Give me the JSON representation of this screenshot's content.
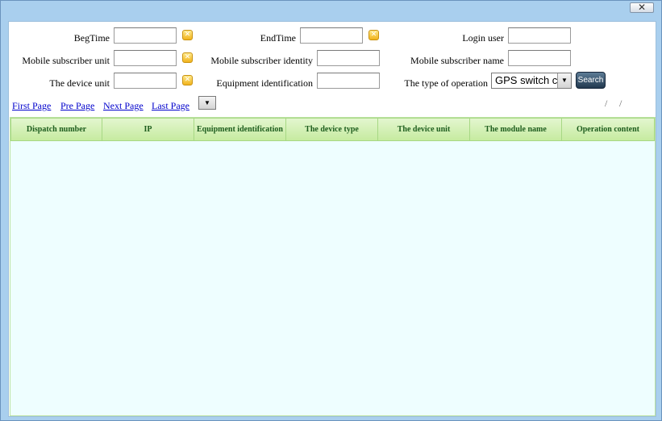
{
  "window": {
    "close_symbol": "✕"
  },
  "filters": {
    "beg_time": {
      "label": "BegTime",
      "value": ""
    },
    "end_time": {
      "label": "EndTime",
      "value": ""
    },
    "login_user": {
      "label": "Login user",
      "value": ""
    },
    "mobile_subscriber_unit": {
      "label": "Mobile subscriber unit",
      "value": ""
    },
    "mobile_subscriber_identity": {
      "label": "Mobile subscriber identity",
      "value": ""
    },
    "mobile_subscriber_name": {
      "label": "Mobile subscriber name",
      "value": ""
    },
    "device_unit": {
      "label": "The device unit",
      "value": ""
    },
    "equipment_identification": {
      "label": "Equipment identification",
      "value": ""
    },
    "operation_type": {
      "label": "The type of operation",
      "selected": "GPS switch c"
    },
    "clear_symbol": "✕",
    "search_label": "Search"
  },
  "pager": {
    "first": "First Page",
    "prev": "Pre Page",
    "next": "Next Page",
    "last": "Last Page",
    "dropdown_arrow": "▼",
    "slash": "/"
  },
  "grid": {
    "columns": [
      "Dispatch number",
      "IP",
      "Equipment identification",
      "The device type",
      "The device unit",
      "The module name",
      "Operation content"
    ],
    "rows": []
  },
  "icons": {
    "close": "close-icon",
    "clear": "clear-field-icon",
    "dropdown": "chevron-down-icon"
  },
  "colors": {
    "window_bg": "#a9cfee",
    "grid_bg": "#eefeff",
    "header_text": "#1d5c1d",
    "link": "#0000cc",
    "search_button": "#2e4a63"
  }
}
